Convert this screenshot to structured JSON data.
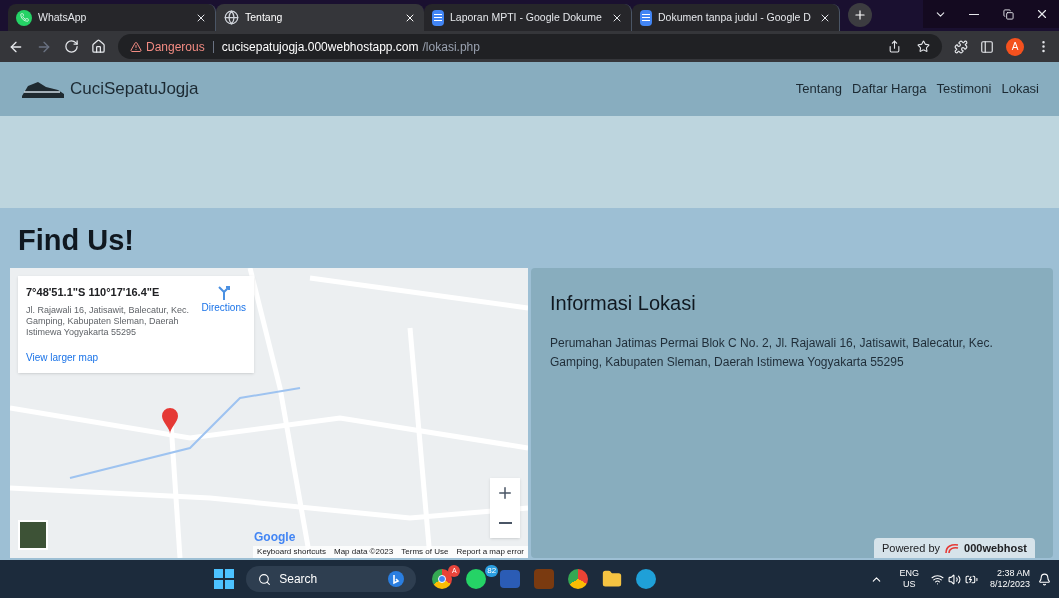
{
  "browser": {
    "tabs": [
      {
        "title": "WhatsApp",
        "kind": "chat",
        "selected": false
      },
      {
        "title": "Tentang",
        "kind": "web",
        "selected": true
      },
      {
        "title": "Laporan MPTI - Google Dokume",
        "kind": "document",
        "selected": false
      },
      {
        "title": "Dokumen tanpa judul - Google D",
        "kind": "document",
        "selected": false
      }
    ],
    "address": {
      "warning": "Dangerous",
      "host": "cucisepatujogja.000webhostapp.com",
      "path": "/lokasi.php"
    },
    "profile": "A"
  },
  "site": {
    "brand": "CuciSepatuJogja",
    "nav": [
      {
        "label": "Tentang"
      },
      {
        "label": "Daftar Harga"
      },
      {
        "label": "Testimoni"
      },
      {
        "label": "Lokasi"
      }
    ],
    "heading": "Find Us!",
    "map": {
      "coords": "7°48'51.1\"S 110°17'16.4\"E",
      "address": "Jl. Rajawali 16, Jatisawit, Balecatur, Kec. Gamping, Kabupaten Sleman, Daerah Istimewa Yogyakarta 55295",
      "directions": "Directions",
      "larger": "View larger map",
      "logo": "Google",
      "attribution": [
        "Keyboard shortcuts",
        "Map data ©2023",
        "Terms of Use",
        "Report a map error"
      ]
    },
    "info": {
      "title": "Informasi Lokasi",
      "text": "Perumahan Jatimas Permai Blok C No. 2, Jl. Rajawali 16, Jatisawit, Balecatur, Kec. Gamping, Kabupaten Sleman, Daerah Istimewa Yogyakarta 55295"
    },
    "powered": {
      "label": "Powered by",
      "brand": "000webhost"
    }
  },
  "taskbar": {
    "search": "Search",
    "chrome_badge": "A",
    "whatsapp_badge": "82",
    "lang": "ENG",
    "region": "US",
    "time": "2:38 AM",
    "date": "8/12/2023"
  }
}
